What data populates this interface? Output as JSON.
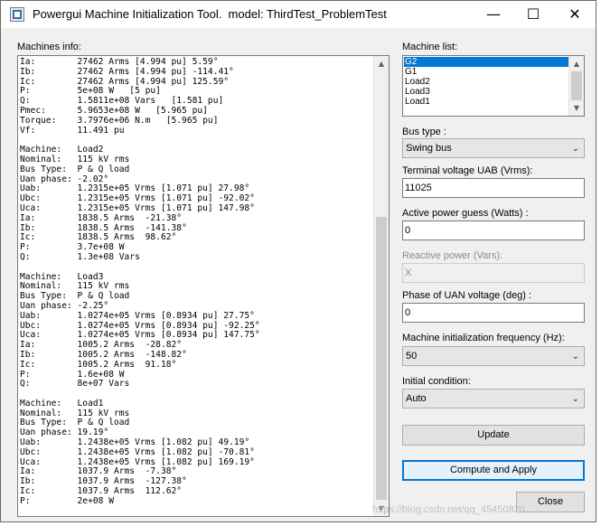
{
  "window": {
    "title": "Powergui Machine Initialization Tool.  model: ThirdTest_ProblemTest",
    "minimize_glyph": "—",
    "maximize_glyph": "☐",
    "close_glyph": "✕"
  },
  "machines_info": {
    "label": "Machines info:",
    "lines": [
      "Ia:        27462 Arms [4.994 pu] 5.59°",
      "Ib:        27462 Arms [4.994 pu] -114.41°",
      "Ic:        27462 Arms [4.994 pu] 125.59°",
      "P:         5e+08 W   [5 pu]",
      "Q:         1.5811e+08 Vars   [1.581 pu]",
      "Pmec:      5.9653e+08 W   [5.965 pu]",
      "Torque:    3.7976e+06 N.m   [5.965 pu]",
      "Vf:        11.491 pu",
      "",
      "Machine:   Load2",
      "Nominal:   115 kV rms",
      "Bus Type:  P & Q load",
      "Uan phase: -2.02°",
      "Uab:       1.2315e+05 Vrms [1.071 pu] 27.98°",
      "Ubc:       1.2315e+05 Vrms [1.071 pu] -92.02°",
      "Uca:       1.2315e+05 Vrms [1.071 pu] 147.98°",
      "Ia:        1838.5 Arms  -21.38°",
      "Ib:        1838.5 Arms  -141.38°",
      "Ic:        1838.5 Arms  98.62°",
      "P:         3.7e+08 W",
      "Q:         1.3e+08 Vars",
      "",
      "Machine:   Load3",
      "Nominal:   115 kV rms",
      "Bus Type:  P & Q load",
      "Uan phase: -2.25°",
      "Uab:       1.0274e+05 Vrms [0.8934 pu] 27.75°",
      "Ubc:       1.0274e+05 Vrms [0.8934 pu] -92.25°",
      "Uca:       1.0274e+05 Vrms [0.8934 pu] 147.75°",
      "Ia:        1005.2 Arms  -28.82°",
      "Ib:        1005.2 Arms  -148.82°",
      "Ic:        1005.2 Arms  91.18°",
      "P:         1.6e+08 W",
      "Q:         8e+07 Vars",
      "",
      "Machine:   Load1",
      "Nominal:   115 kV rms",
      "Bus Type:  P & Q load",
      "Uan phase: 19.19°",
      "Uab:       1.2438e+05 Vrms [1.082 pu] 49.19°",
      "Ubc:       1.2438e+05 Vrms [1.082 pu] -70.81°",
      "Uca:       1.2438e+05 Vrms [1.082 pu] 169.19°",
      "Ia:        1037.9 Arms  -7.38°",
      "Ib:        1037.9 Arms  -127.38°",
      "Ic:        1037.9 Arms  112.62°",
      "P:         2e+08 W"
    ]
  },
  "machine_list": {
    "label": "Machine list:",
    "items": [
      "G2",
      "G1",
      "Load2",
      "Load3",
      "Load1"
    ],
    "selected": "G2"
  },
  "bus_type": {
    "label": "Bus type :",
    "value": "Swing bus"
  },
  "terminal_voltage": {
    "label": "Terminal voltage UAB (Vrms):",
    "value": "11025"
  },
  "active_power": {
    "label": "Active power guess (Watts) :",
    "value": "0"
  },
  "reactive_power": {
    "label": "Reactive power (Vars):",
    "value": "X"
  },
  "phase_uan": {
    "label": "Phase of UAN voltage (deg) :",
    "value": "0"
  },
  "init_frequency": {
    "label": "Machine initialization frequency (Hz):",
    "value": "50"
  },
  "initial_condition": {
    "label": "Initial condition:",
    "value": "Auto"
  },
  "buttons": {
    "update": "Update",
    "compute_apply": "Compute and Apply",
    "close": "Close"
  },
  "watermark": "https://blog.csdn.net/qq_45450820"
}
